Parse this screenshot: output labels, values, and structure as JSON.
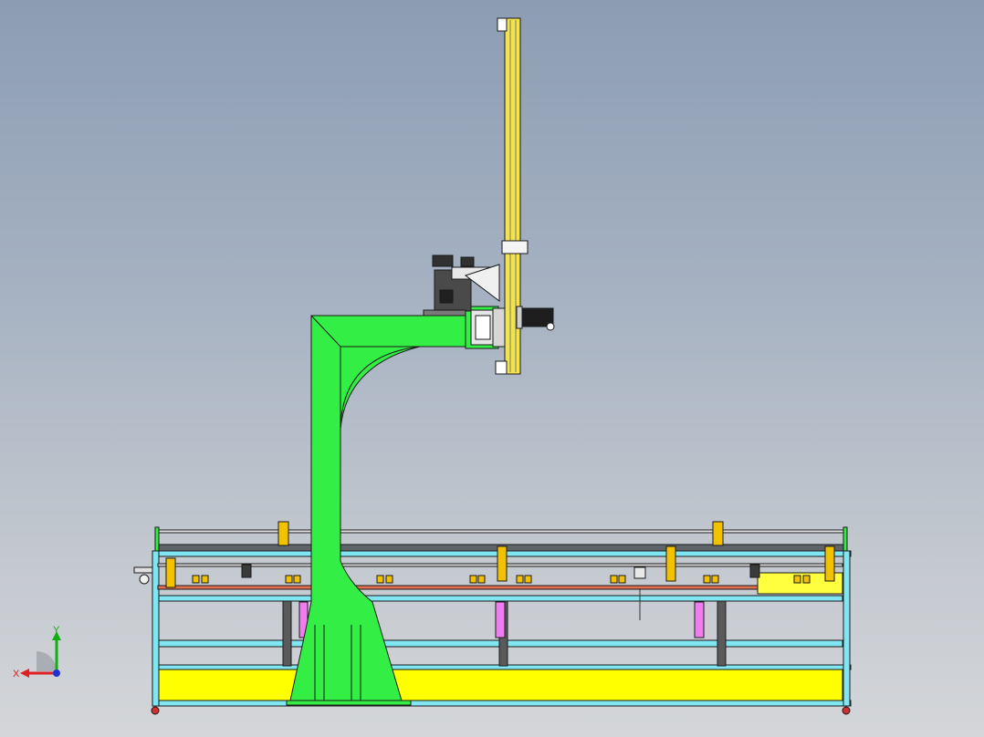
{
  "view": {
    "background_top": "#8c9db3",
    "background_bottom": "#d4d6d9"
  },
  "colors": {
    "column": "#33ee44",
    "frame": "#7fe6f2",
    "plate": "#ffff00",
    "block": "#f2c200",
    "pink": "#f07df0",
    "rail": "#e07050",
    "steel": "#bfc3c6",
    "outline": "#1a1a1a"
  },
  "triad": {
    "x_label": "X",
    "y_label": "Y",
    "x_color": "#e02020",
    "y_color": "#10b010",
    "z_color": "#2030d0"
  }
}
